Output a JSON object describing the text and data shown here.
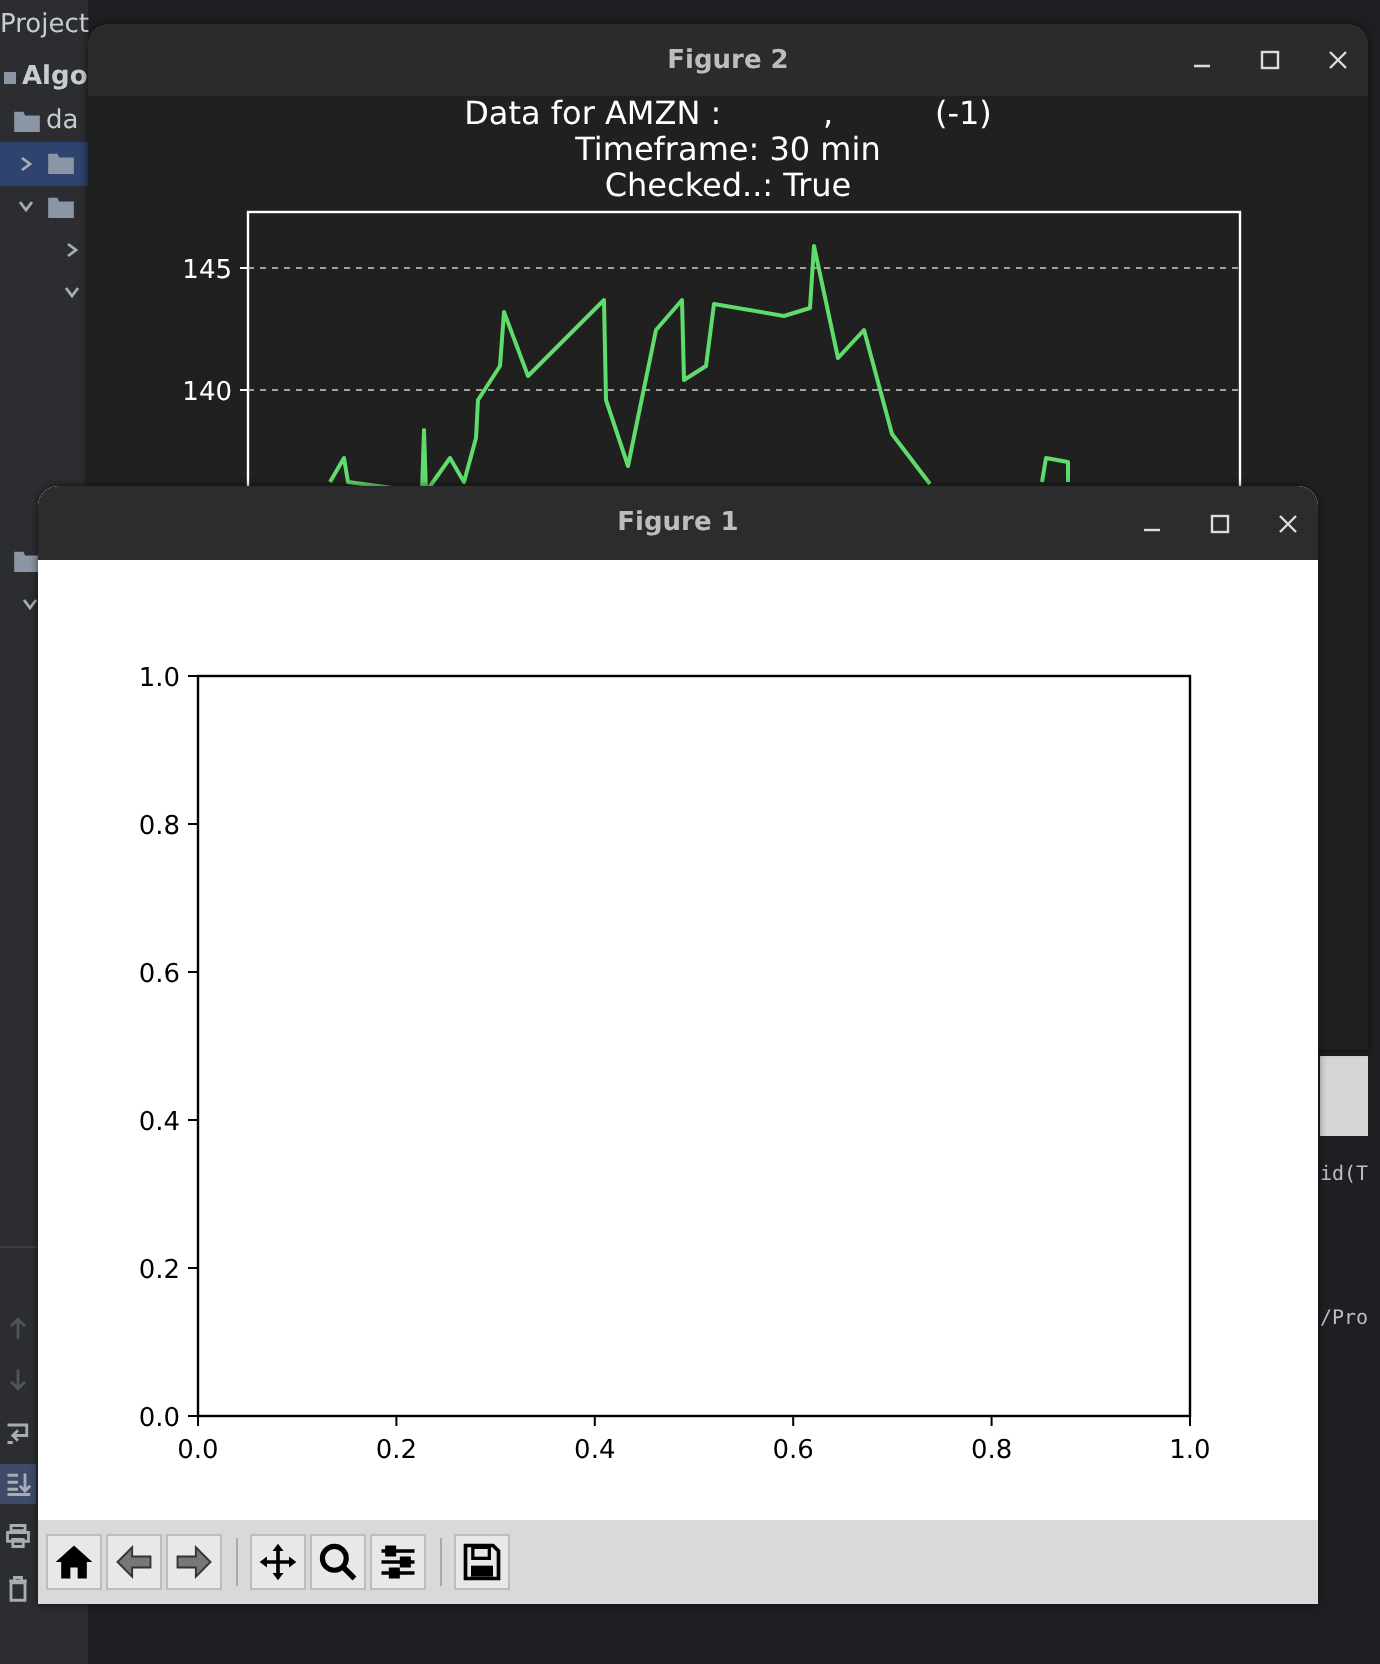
{
  "ide": {
    "project_tab": "Project",
    "tree": [
      {
        "label": "Algo",
        "kind": "module",
        "children": [
          {
            "label": "da",
            "kind": "folder"
          },
          {
            "kind": "folder",
            "expanded": false,
            "selected": true
          },
          {
            "kind": "folder",
            "expanded": true,
            "selected": false,
            "children": [
              {
                "kind": "chevron",
                "expanded": false,
                "selected": false
              },
              {
                "kind": "chevron",
                "expanded": true,
                "selected": false
              }
            ]
          }
        ]
      }
    ],
    "tree_lower": [
      {
        "kind": "folder"
      },
      {
        "kind": "chevron",
        "expanded": true,
        "selected": false
      }
    ],
    "side_tools": [
      {
        "kind": "up",
        "disabled": true,
        "selected": false
      },
      {
        "kind": "down",
        "disabled": true,
        "selected": false
      },
      {
        "kind": "wrap",
        "disabled": false,
        "selected": false
      },
      {
        "kind": "scroll_end",
        "disabled": false,
        "selected": true
      },
      {
        "kind": "print",
        "disabled": false,
        "selected": false
      },
      {
        "kind": "trash",
        "disabled": false,
        "selected": false
      }
    ],
    "code_fragments": [
      "id(T",
      "/Pro"
    ]
  },
  "figure2": {
    "title": "Figure 2",
    "title_lines": [
      "Data for AMZN :          ,          (-1)",
      "Timeframe: 30 min",
      "Checked..: True"
    ],
    "y_tick_labels": [
      "145",
      "140"
    ]
  },
  "figure1": {
    "title": "Figure 1",
    "chart_data": {
      "type": "line",
      "xlim": [
        0,
        1
      ],
      "ylim": [
        0,
        1
      ],
      "xticks": [
        {
          "value": 0,
          "label": "0.0"
        },
        {
          "value": 0.2,
          "label": "0.2"
        },
        {
          "value": 0.4,
          "label": "0.4"
        },
        {
          "value": 0.6,
          "label": "0.6"
        },
        {
          "value": 0.8,
          "label": "0.8"
        },
        {
          "value": 1,
          "label": "1.0"
        }
      ],
      "yticks": [
        {
          "value": 0,
          "label": "0.0"
        },
        {
          "value": 0.2,
          "label": "0.2"
        },
        {
          "value": 0.4,
          "label": "0.4"
        },
        {
          "value": 0.6,
          "label": "0.6"
        },
        {
          "value": 0.8,
          "label": "0.8"
        },
        {
          "value": 1,
          "label": "1.0"
        }
      ]
    },
    "toolbar": [
      [
        {
          "kind": "home"
        },
        {
          "kind": "back"
        },
        {
          "kind": "forward"
        }
      ],
      [
        {
          "kind": "pan"
        },
        {
          "kind": "zoom"
        },
        {
          "kind": "configure"
        }
      ],
      [
        {
          "kind": "save"
        }
      ]
    ]
  }
}
